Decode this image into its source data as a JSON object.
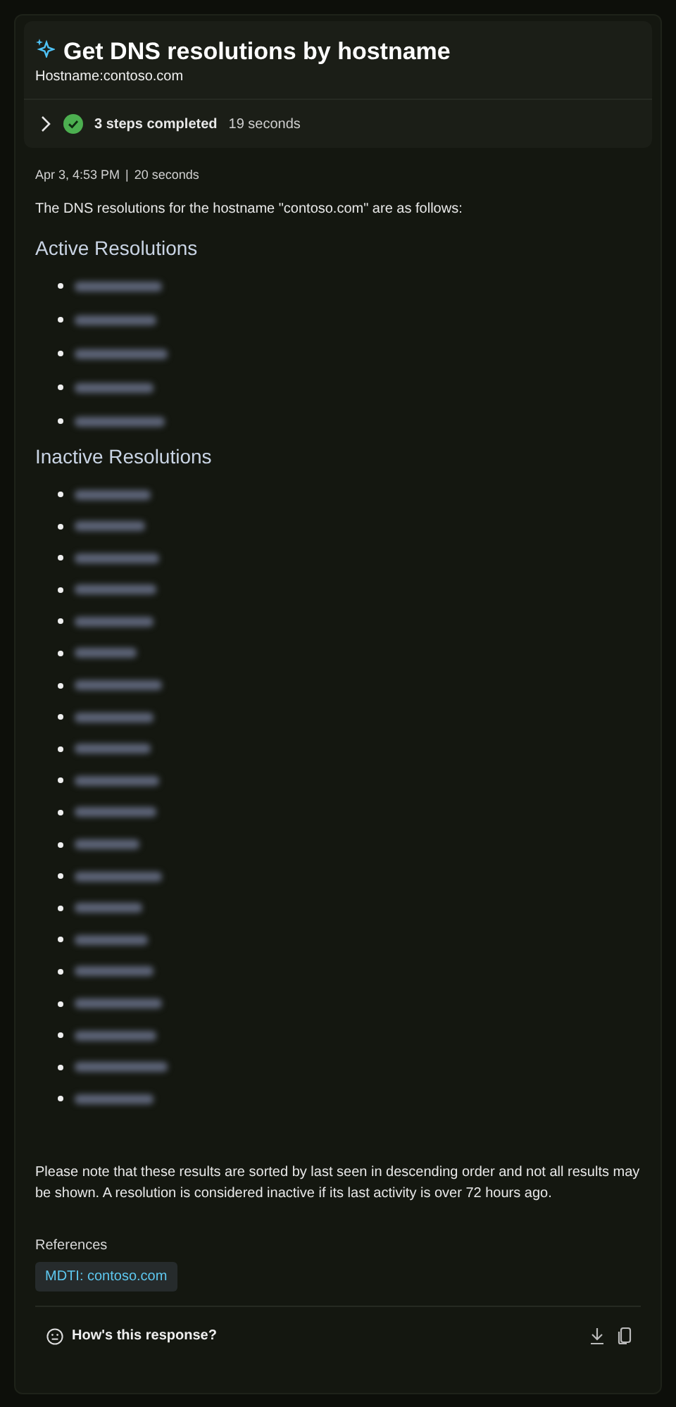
{
  "header": {
    "title": "Get DNS resolutions by hostname",
    "subtitle": "Hostname:contoso.com"
  },
  "steps": {
    "expanded": false,
    "done": true,
    "label": "3 steps completed",
    "duration": "19 seconds"
  },
  "meta": {
    "date": "Apr 3, 4:53 PM",
    "separator": "|",
    "duration": "20 seconds"
  },
  "intro": "The DNS resolutions for the hostname \"contoso.com\" are as follows:",
  "sections": [
    {
      "heading": "Active Resolutions",
      "items": [
        {
          "kind": "redacted"
        },
        {
          "kind": "redacted"
        },
        {
          "kind": "redacted"
        },
        {
          "kind": "redacted"
        },
        {
          "kind": "redacted"
        }
      ]
    },
    {
      "heading": "Inactive Resolutions",
      "items": [
        {
          "kind": "redacted"
        },
        {
          "kind": "redacted"
        },
        {
          "kind": "redacted"
        },
        {
          "kind": "redacted"
        },
        {
          "kind": "redacted"
        },
        {
          "kind": "redacted"
        },
        {
          "kind": "redacted"
        },
        {
          "kind": "redacted"
        },
        {
          "kind": "redacted"
        },
        {
          "kind": "redacted"
        },
        {
          "kind": "redacted"
        },
        {
          "kind": "redacted"
        },
        {
          "kind": "redacted"
        },
        {
          "kind": "redacted"
        },
        {
          "kind": "redacted"
        },
        {
          "kind": "redacted"
        },
        {
          "kind": "redacted"
        },
        {
          "kind": "redacted"
        },
        {
          "kind": "redacted"
        },
        {
          "kind": "redacted"
        }
      ]
    }
  ],
  "note": "Please note that these results are sorted by last seen in descending order and not all results may be shown. A resolution is considered inactive if its last activity is over 72 hours ago.",
  "references": {
    "heading": "References",
    "links": [
      "MDTI: contoso.com"
    ]
  },
  "feedback": {
    "label": "How's this response?"
  }
}
